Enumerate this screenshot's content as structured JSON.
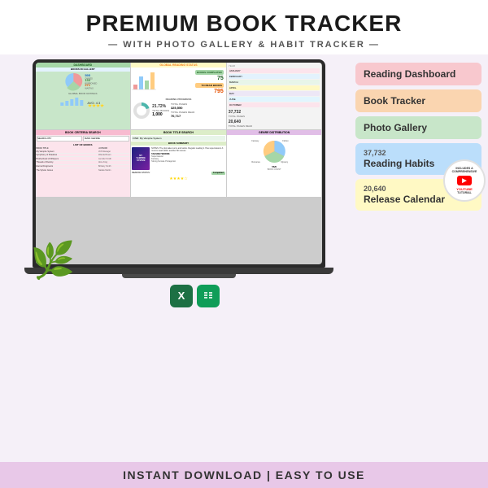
{
  "header": {
    "title": "PREMIUM BOOK TRACKER",
    "subtitle": "— WITH PHOTO GALLERY & HABIT TRACKER —"
  },
  "features": [
    {
      "id": "dashboard",
      "label": "Reading Dashboard",
      "color": "pink",
      "stat": null
    },
    {
      "id": "book-tracker",
      "label": "Book Tracker",
      "color": "peach",
      "stat": null
    },
    {
      "id": "photo-gallery",
      "label": "Photo Gallery",
      "color": "green",
      "stat": null
    },
    {
      "id": "reading-habits",
      "label": "Reading Habits",
      "color": "blue",
      "stat": null
    },
    {
      "id": "release-calendar",
      "label": "Release Calendar",
      "color": "yellow",
      "stat": null
    }
  ],
  "sidebar_stats": {
    "total_pages": "37,732",
    "total_pages_label": "TOTAL PAGES",
    "total_pages_read": "20,640",
    "total_pages_read_label": "TOTAL PAGES READ"
  },
  "dashboard": {
    "title": "DASHBOARD",
    "books_in_gallery": "BOOKS IN GALLERY",
    "owned": "595",
    "borrowed": "133",
    "waiting": "271",
    "avg_rating": "4.3",
    "total_books": "1,000",
    "total_pages": "325,550",
    "total_pages_read_val": "70,717",
    "reading_progress_pct": "21.72%"
  },
  "global_reading": {
    "title": "GLOBAL READING STATUS",
    "books_completed": "75",
    "to_read": "795"
  },
  "bottom": {
    "text": "INSTANT DOWNLOAD | EASY TO USE"
  },
  "icons": {
    "excel_label": "X",
    "sheets_label": "▦"
  },
  "badge": {
    "line1": "INCLUDES A COMPREHENSIVE",
    "line2": "YOUTUBE",
    "line3": "TUTORIAL"
  }
}
